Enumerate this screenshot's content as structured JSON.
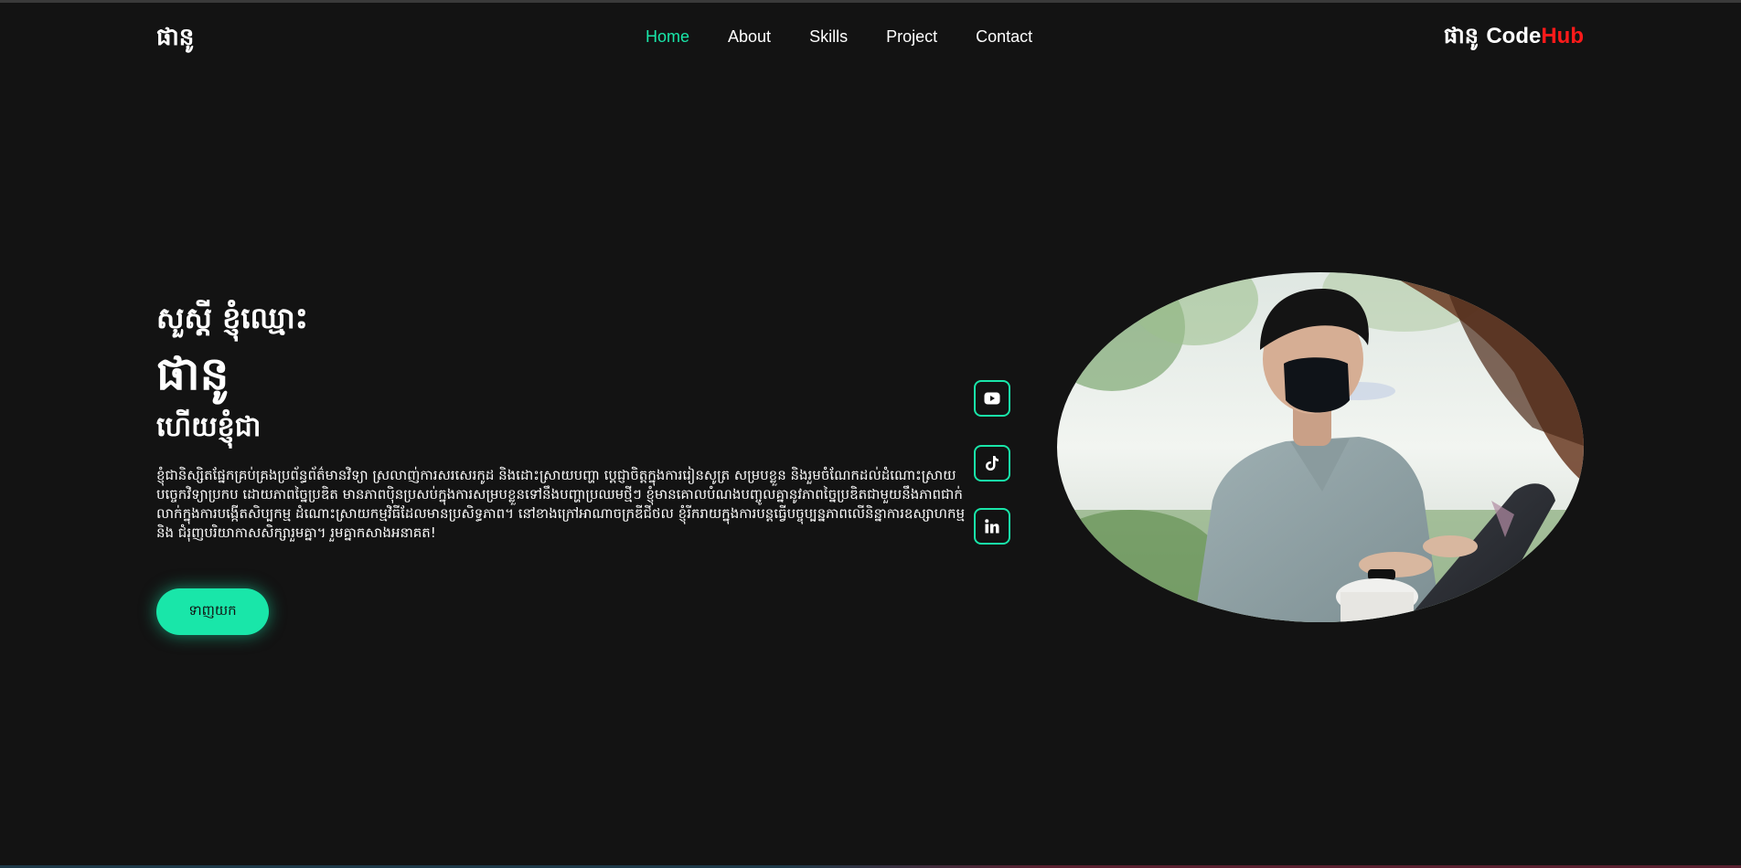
{
  "header": {
    "logo": "ផានូ",
    "nav": [
      {
        "label": "Home",
        "active": true
      },
      {
        "label": "About",
        "active": false
      },
      {
        "label": "Skills",
        "active": false
      },
      {
        "label": "Project",
        "active": false
      },
      {
        "label": "Contact",
        "active": false
      }
    ],
    "brand": {
      "name": "ផានូ",
      "code": "Code",
      "hub": "Hub"
    }
  },
  "hero": {
    "greeting": "សួស្តី ខ្ញុំឈ្មោះ",
    "name": "ផានូ",
    "role_intro": "ហើយខ្ញុំជា",
    "bio": "ខ្ញុំជានិស្សិតផ្នែកគ្រប់គ្រងប្រព័ន្ធព័ត៌មានវិទ្យា ស្រលាញ់ការសរសេរកូដ និងដោះស្រាយបញ្ហា ប្តេជ្ញាចិត្តក្នុងការរៀនសូត្រ សម្របខ្លួន និងរួមចំណែកដល់ដំណោះស្រាយបច្ចេកវិទ្យាប្រកប ដោយភាពច្នៃប្រឌិត មានភាពប៉ិនប្រសប់ក្នុងការសម្របខ្លួនទៅនឹងបញ្ហាប្រឈមថ្មីៗ ខ្ញុំមានគោលបំណងបញ្ចូលគ្នានូវភាពច្នៃប្រឌិតជាមួយនឹងភាពជាក់លាក់ក្នុងការបង្កើតសិប្បកម្ម ដំណោះស្រាយកម្មវិធីដែលមានប្រសិទ្ធភាព។ នៅខាងក្រៅអាណាចក្រឌីជីថល ខ្ញុំរីករាយក្នុងការបន្តធ្វើបច្ចុប្បន្នភាពលើនិន្នាការឧស្សាហកម្ម និង ជំរុញបរិយាកាសសិក្សារួមគ្នា។ រួមគ្នាកសាងអនាគត!",
    "download_label": "ទាញយក"
  },
  "social": [
    {
      "icon": "youtube-icon"
    },
    {
      "icon": "tiktok-icon"
    },
    {
      "icon": "linkedin-icon"
    }
  ],
  "colors": {
    "accent": "#19e6a9",
    "background": "#131313",
    "hub_red": "#ff1a1a"
  }
}
